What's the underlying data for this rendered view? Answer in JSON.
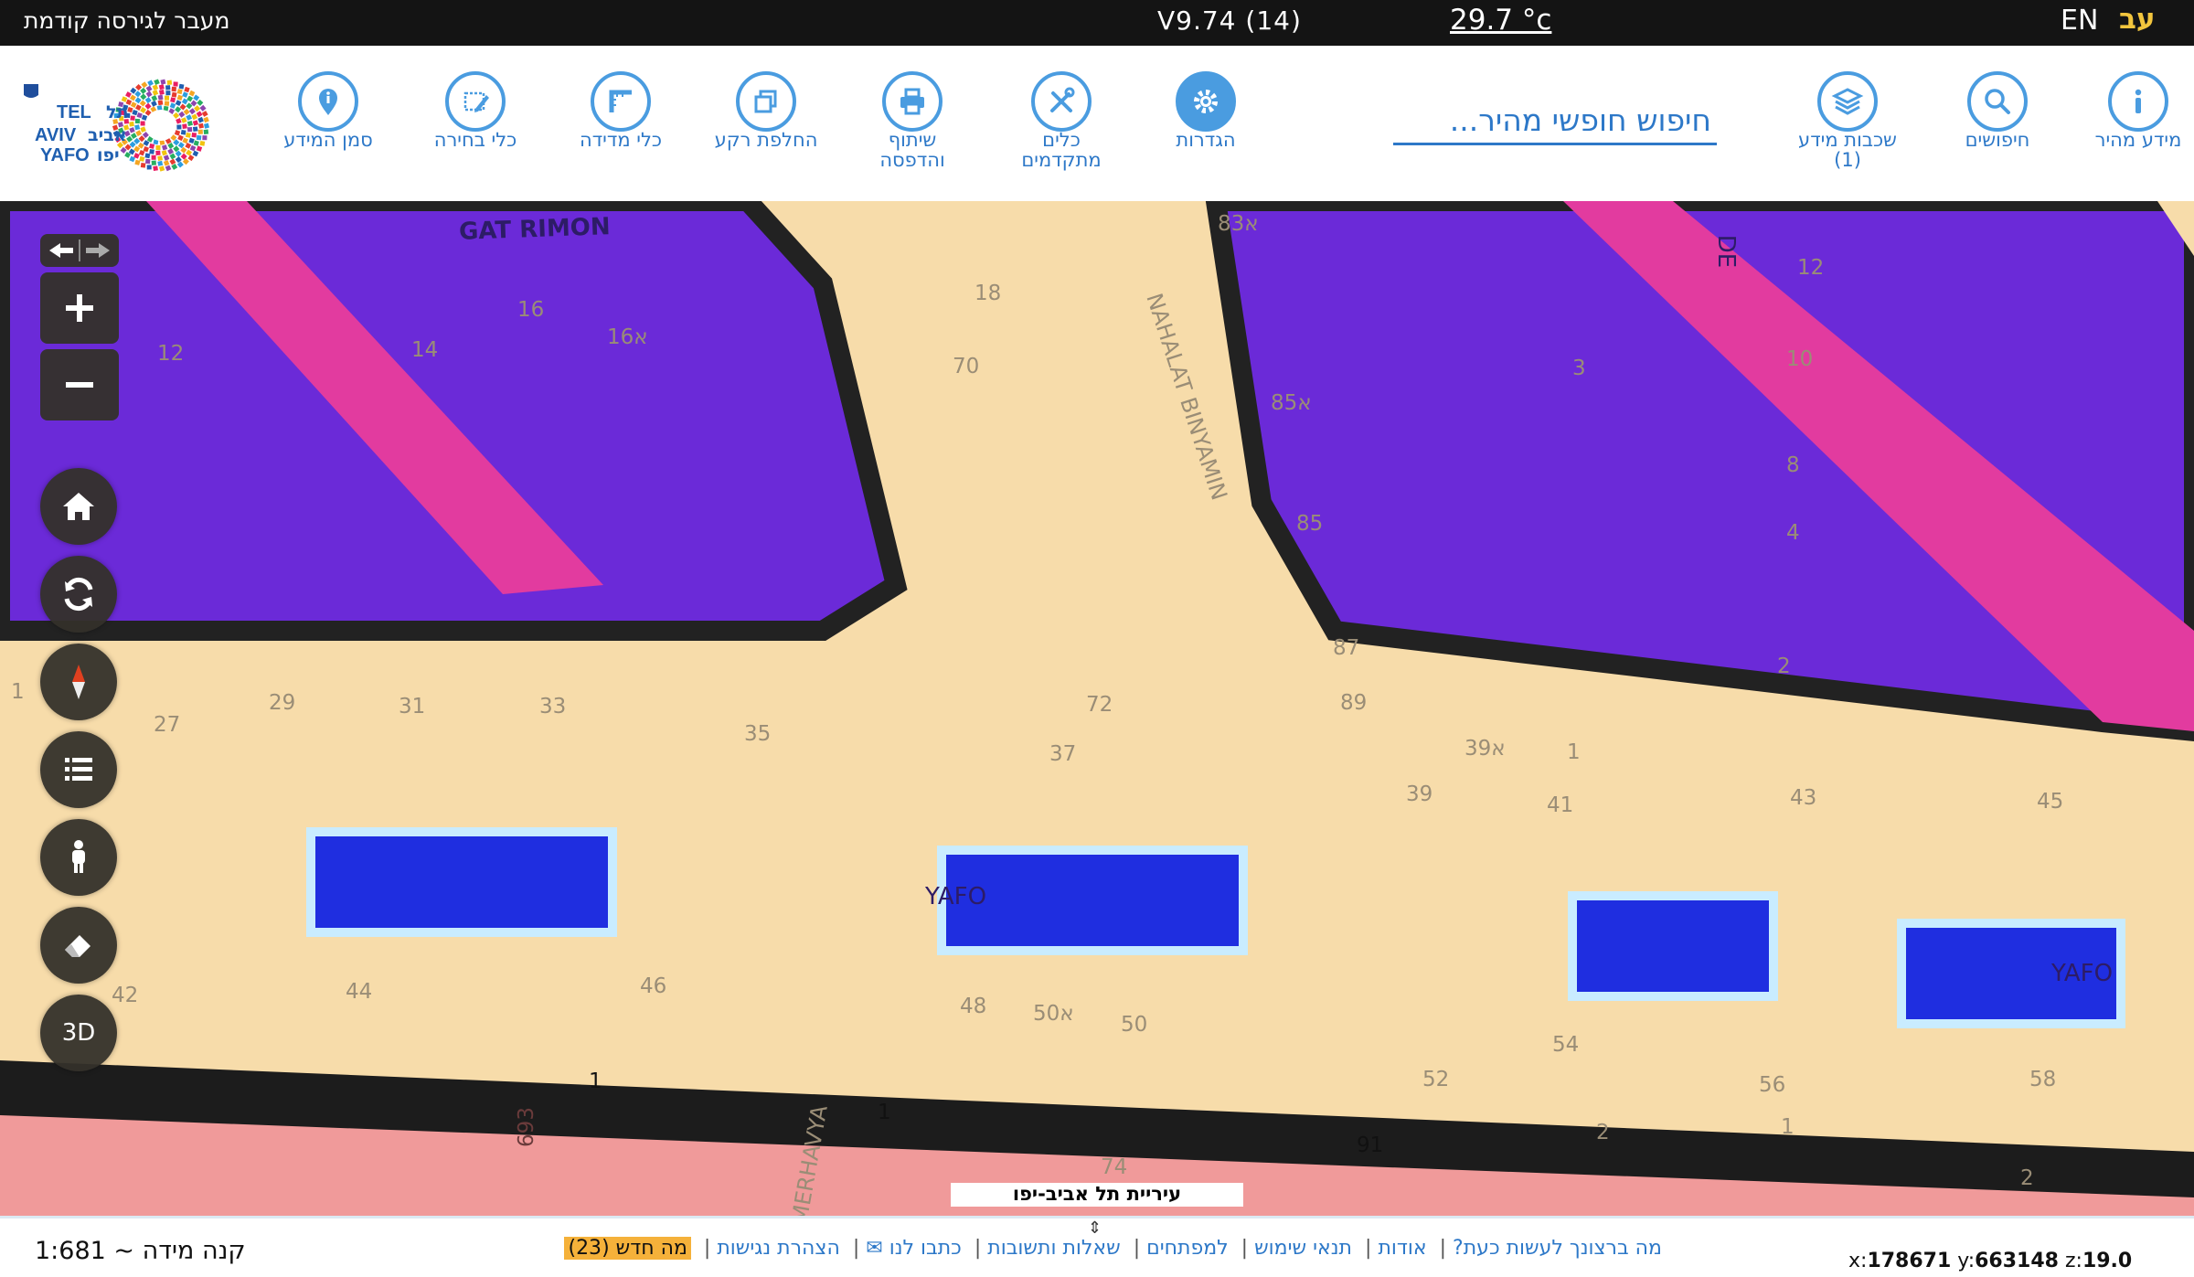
{
  "topbar": {
    "prev_version": "מעבר לגירסה קודמת",
    "version": "V9.74 (14)",
    "temperature": "29.7 °c",
    "lang_en": "EN",
    "lang_he": "עב"
  },
  "toolbar": {
    "tools": [
      {
        "label": "מידע מהיר",
        "icon": "info-icon"
      },
      {
        "label": "חיפושים",
        "icon": "search-icon"
      },
      {
        "label": "שכבות מידע",
        "sub": "(1)",
        "icon": "layers-icon"
      },
      {
        "label": "הגדרות",
        "icon": "gear-icon"
      },
      {
        "label": "כלים",
        "sub": "מתקדמים",
        "icon": "tools-icon"
      },
      {
        "label": "שיתוף",
        "sub": "והדפסה",
        "icon": "print-icon"
      },
      {
        "label": "החלפת רקע",
        "icon": "background-icon"
      },
      {
        "label": "כלי מדידה",
        "icon": "ruler-icon"
      },
      {
        "label": "כלי בחירה",
        "icon": "select-icon"
      },
      {
        "label": "סמן המידע",
        "icon": "pin-icon"
      }
    ],
    "search_placeholder": "חיפוש חופשי מהיר..."
  },
  "logo": {
    "text_en": [
      "TEL",
      "AVIV",
      "YAFO"
    ],
    "text_he": [
      "תל",
      "אביב",
      "יפו"
    ]
  },
  "map": {
    "street_labels": [
      "GAT RIMON",
      "NAHALAT BINYAMIN",
      "YAFO",
      "YAFO",
      "MERHAVYA",
      "DE"
    ],
    "parcel_numbers": [
      "18",
      "70",
      "16",
      "16א",
      "12",
      "14",
      "83א",
      "85א",
      "85",
      "87",
      "89",
      "3",
      "2",
      "12",
      "10",
      "8",
      "4",
      "29",
      "31",
      "33",
      "35",
      "37",
      "72",
      "39",
      "39א",
      "41",
      "43",
      "45",
      "27",
      "1",
      "1",
      "42",
      "44",
      "46",
      "48",
      "50א",
      "50",
      "54",
      "52",
      "56",
      "58",
      "1",
      "1",
      "2",
      "1",
      "2",
      "91",
      "74",
      "693"
    ],
    "banner": "עיריית תל אביב-יפו"
  },
  "controls": {
    "three_d": "3D"
  },
  "bottombar": {
    "scale_label": "קנה מידה ~ 1:681",
    "links": [
      "מה ברצונך לעשות כעת?",
      "אודות",
      "תנאי שימוש",
      "למפתחים",
      "שאלות ותשובות",
      "כתבו לנו ✉",
      "הצהרת נגישות"
    ],
    "whats_new": "מה חדש (23)",
    "coords": {
      "x": "178671",
      "y": "663148",
      "z": "19.0"
    }
  }
}
